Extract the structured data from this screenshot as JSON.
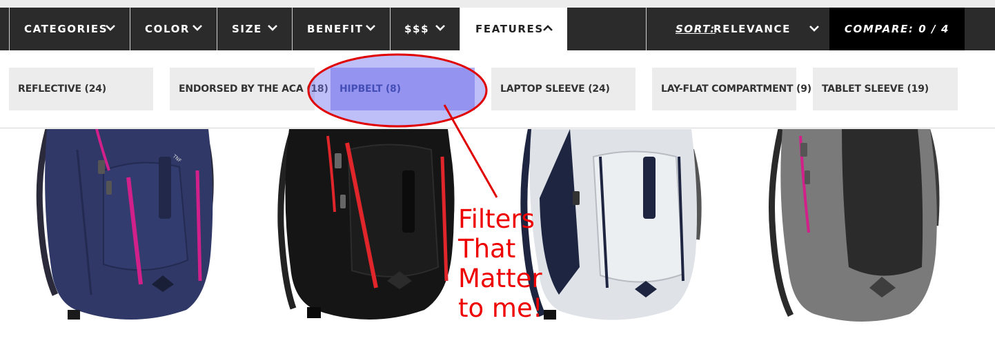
{
  "nav": {
    "tabs": [
      {
        "label": "CATEGORIES"
      },
      {
        "label": "COLOR"
      },
      {
        "label": "SIZE"
      },
      {
        "label": "BENEFIT"
      },
      {
        "label": "$$$"
      },
      {
        "label": "FEATURES"
      }
    ],
    "sort_prefix": "SORT:",
    "sort_value": "RELEVANCE",
    "compare": "COMPARE: 0 / 4"
  },
  "filters": [
    {
      "label": "REFLECTIVE (24)"
    },
    {
      "label": "ENDORSED BY THE ACA (18)"
    },
    {
      "label": "HIPBELT (8)"
    },
    {
      "label": "LAPTOP SLEEVE (24)"
    },
    {
      "label": "LAY-FLAT COMPARTMENT (9)"
    },
    {
      "label": "TABLET SLEEVE (19)"
    }
  ],
  "annotation": {
    "lines": [
      "Filters",
      "That",
      "Matter",
      "to me!"
    ],
    "color": "#ee0000"
  },
  "products": {
    "brand_mark": "THE NORTH FACE",
    "colors": [
      "#2f3866",
      "#151515",
      "#dfe3e8",
      "#7a7a7a"
    ],
    "accents": [
      "#d2208a",
      "#e0262a",
      "#1d2540",
      "#d2208a"
    ]
  },
  "colors": {
    "nav_bg": "#2b2b2b",
    "chip_bg": "#ececec",
    "chip_selected": "#b2b2f0"
  }
}
